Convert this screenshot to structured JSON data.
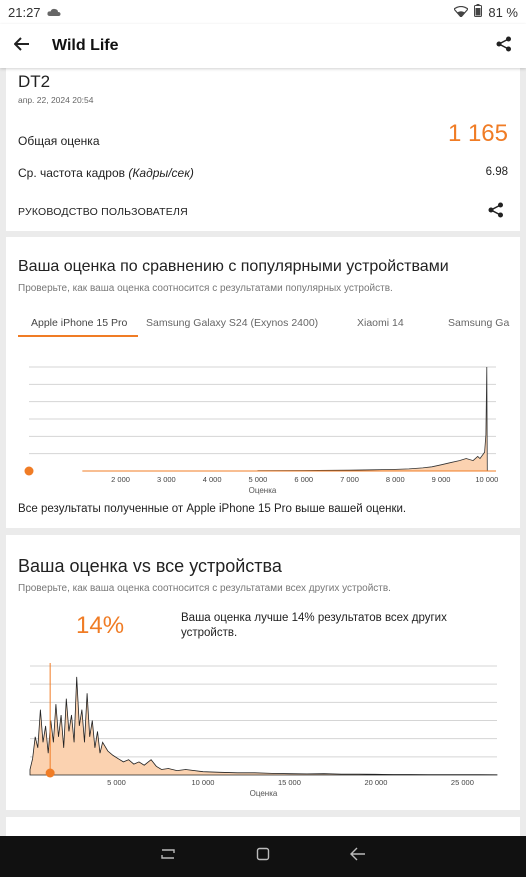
{
  "status": {
    "time": "21:27",
    "battery": "81 %"
  },
  "app": {
    "title": "Wild Life"
  },
  "result": {
    "device": "DT2",
    "date": "апр. 22, 2024 20:54",
    "overall_label": "Общая оценка",
    "overall_value": "1 165",
    "fps_label": "Ср. частота кадров",
    "fps_unit": "(Кадры/сек)",
    "fps_value": "6.98",
    "guide_label": "РУКОВОДСТВО ПОЛЬЗОВАТЕЛЯ"
  },
  "compare": {
    "title": "Ваша оценка по сравнению с популярными устройствами",
    "subtitle": "Проверьте, как ваша оценка соотносится с результатами популярных устройств.",
    "tabs": [
      "Apple iPhone 15 Pro",
      "Samsung Galaxy S24 (Exynos 2400)",
      "Xiaomi 14",
      "Samsung Ga"
    ],
    "note": "Все результаты полученные от Apple iPhone 15 Pro выше вашей оценки."
  },
  "all": {
    "title": "Ваша оценка vs все устройства",
    "subtitle": "Проверьте, как ваша оценка соотносится с результатами всех других устройств.",
    "percent": "14%",
    "better_text": "Ваша оценка лучше 14% результатов всех других устройств."
  },
  "chart_data": [
    {
      "type": "area",
      "title": "",
      "xlabel": "Оценка",
      "ylabel": "",
      "xlim": [
        0,
        10200
      ],
      "xticks": [
        "2 000",
        "3 000",
        "4 000",
        "5 000",
        "6 000",
        "7 000",
        "8 000",
        "9 000",
        "10 000"
      ],
      "marker_score": 1165,
      "series": [
        {
          "color": "#f07c25",
          "x": [
            5000,
            6000,
            7000,
            7500,
            8000,
            8300,
            8600,
            8800,
            9000,
            9200,
            9400,
            9550,
            9700,
            9800,
            9850,
            9900,
            9950,
            9980,
            10000,
            10010
          ],
          "y": [
            0.003,
            0.005,
            0.008,
            0.012,
            0.015,
            0.02,
            0.03,
            0.04,
            0.06,
            0.08,
            0.1,
            0.12,
            0.1,
            0.14,
            0.12,
            0.15,
            0.18,
            0.35,
            1.0,
            0.0
          ]
        }
      ]
    },
    {
      "type": "area",
      "title": "",
      "xlabel": "Оценка",
      "ylabel": "",
      "xlim": [
        0,
        27000
      ],
      "xticks": [
        "5 000",
        "10 000",
        "15 000",
        "20 000",
        "25 000"
      ],
      "marker_score": 1165,
      "marker_label": "14%",
      "series": [
        {
          "color": "#f07c25",
          "x": [
            0,
            150,
            300,
            450,
            600,
            750,
            900,
            1050,
            1200,
            1350,
            1500,
            1650,
            1800,
            1950,
            2100,
            2250,
            2400,
            2550,
            2700,
            2850,
            3000,
            3150,
            3300,
            3450,
            3600,
            3750,
            3900,
            4050,
            4200,
            4500,
            4800,
            5100,
            5400,
            5700,
            6000,
            6300,
            6600,
            7000,
            7300,
            7600,
            8000,
            8500,
            9000,
            10000,
            11000,
            12000,
            13000,
            14000,
            15000,
            16000,
            17000,
            18000,
            19000,
            20000,
            21000,
            22000,
            23000,
            24000,
            25000,
            26000,
            27000
          ],
          "y": [
            0.05,
            0.15,
            0.35,
            0.25,
            0.6,
            0.3,
            0.45,
            0.2,
            0.5,
            0.3,
            0.65,
            0.35,
            0.55,
            0.25,
            0.7,
            0.4,
            0.55,
            0.3,
            0.9,
            0.45,
            0.6,
            0.3,
            0.75,
            0.35,
            0.5,
            0.25,
            0.4,
            0.2,
            0.3,
            0.22,
            0.18,
            0.15,
            0.12,
            0.14,
            0.1,
            0.12,
            0.09,
            0.14,
            0.08,
            0.05,
            0.06,
            0.04,
            0.05,
            0.03,
            0.025,
            0.02,
            0.02,
            0.015,
            0.012,
            0.01,
            0.012,
            0.008,
            0.008,
            0.006,
            0.005,
            0.005,
            0.004,
            0.004,
            0.003,
            0.003,
            0.002
          ]
        }
      ]
    }
  ]
}
